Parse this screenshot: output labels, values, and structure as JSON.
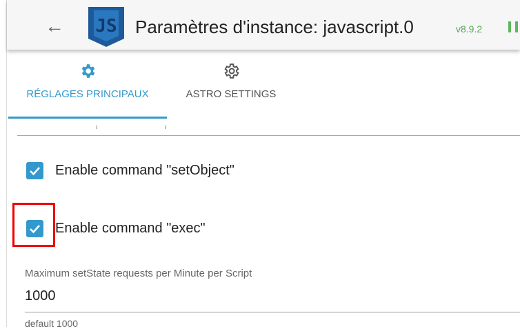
{
  "header": {
    "title": "Paramètres d'instance: javascript.0",
    "version": "v8.9.2",
    "logo_text": "JS"
  },
  "tabs": [
    {
      "label": "RÉGLAGES PRINCIPAUX",
      "active": true
    },
    {
      "label": "ASTRO SETTINGS",
      "active": false
    }
  ],
  "options": [
    {
      "label": "Enable command \"setObject\"",
      "checked": true
    },
    {
      "label": "Enable command \"exec\"",
      "checked": true
    }
  ],
  "field": {
    "label": "Maximum setState requests per Minute per Script",
    "value": "1000",
    "help": "default 1000"
  },
  "colors": {
    "accent": "#3399cc",
    "highlight": "#ee0000",
    "status": "#5cb85c"
  }
}
